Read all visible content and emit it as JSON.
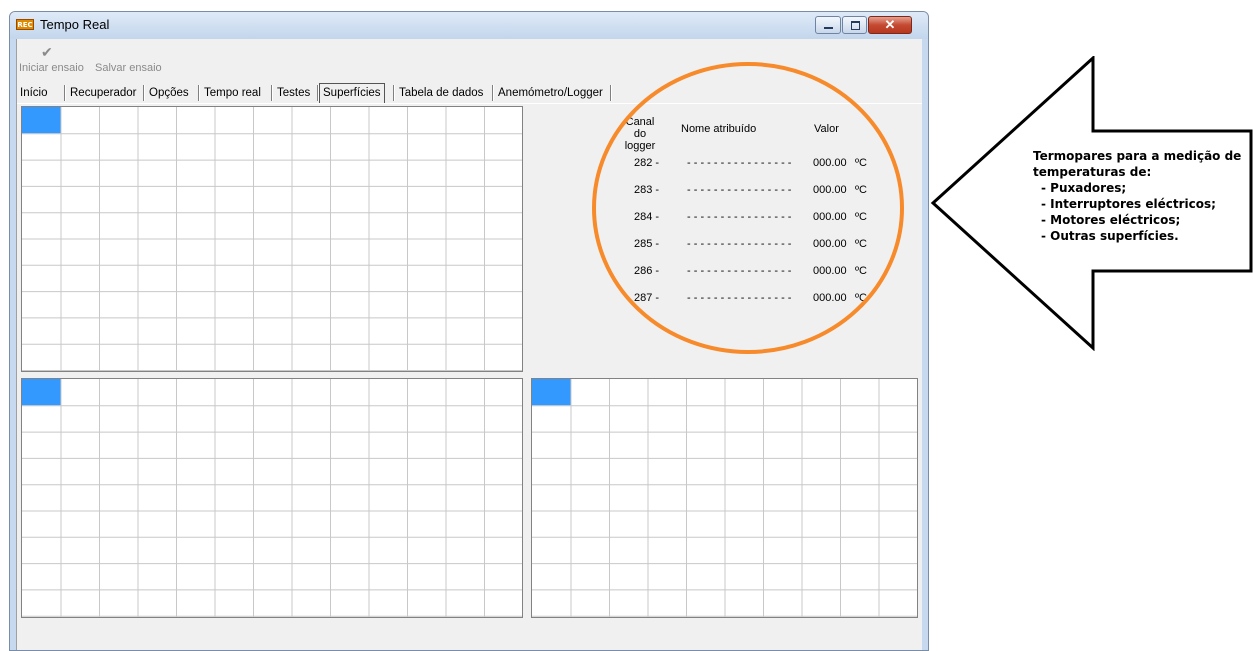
{
  "window": {
    "title": "Tempo Real",
    "app_icon_text": "REC"
  },
  "toolbar": {
    "start_label": "Iniciar ensaio",
    "save_label": "Salvar ensaio"
  },
  "tabs": [
    {
      "label": "Início"
    },
    {
      "label": "Recuperador"
    },
    {
      "label": "Opções"
    },
    {
      "label": "Tempo real"
    },
    {
      "label": "Testes"
    },
    {
      "label": "Superfícies",
      "active": true
    },
    {
      "label": "Tabela de dados"
    },
    {
      "label": "Anemómetro/Logger"
    }
  ],
  "channels": {
    "header_channel": "Canal do logger",
    "header_name": "Nome atribuído",
    "header_value": "Valor",
    "rows": [
      {
        "channel": "282 -",
        "name": "- - - - - - - - - - - - - - - -",
        "value": "000.00",
        "unit": "ºC"
      },
      {
        "channel": "283 -",
        "name": "- - - - - - - - - - - - - - - -",
        "value": "000.00",
        "unit": "ºC"
      },
      {
        "channel": "284 -",
        "name": "- - - - - - - - - - - - - - - -",
        "value": "000.00",
        "unit": "ºC"
      },
      {
        "channel": "285 -",
        "name": "- - - - - - - - - - - - - - - -",
        "value": "000.00",
        "unit": "ºC"
      },
      {
        "channel": "286 -",
        "name": "- - - - - - - - - - - - - - - -",
        "value": "000.00",
        "unit": "ºC"
      },
      {
        "channel": "287 -",
        "name": "- - - - - - - - - - - - - - - -",
        "value": "000.00",
        "unit": "ºC"
      }
    ]
  },
  "callout": {
    "title": "Termopares para a medição de temperaturas de:",
    "items": [
      "- Puxadores;",
      "- Interruptores eléctricos;",
      "- Motores eléctricos;",
      "- Outras superfícies."
    ]
  },
  "colors": {
    "selected_cell": "#3399ff",
    "grid_line": "#c8c8c8",
    "highlight_ellipse": "#f78a2a"
  }
}
